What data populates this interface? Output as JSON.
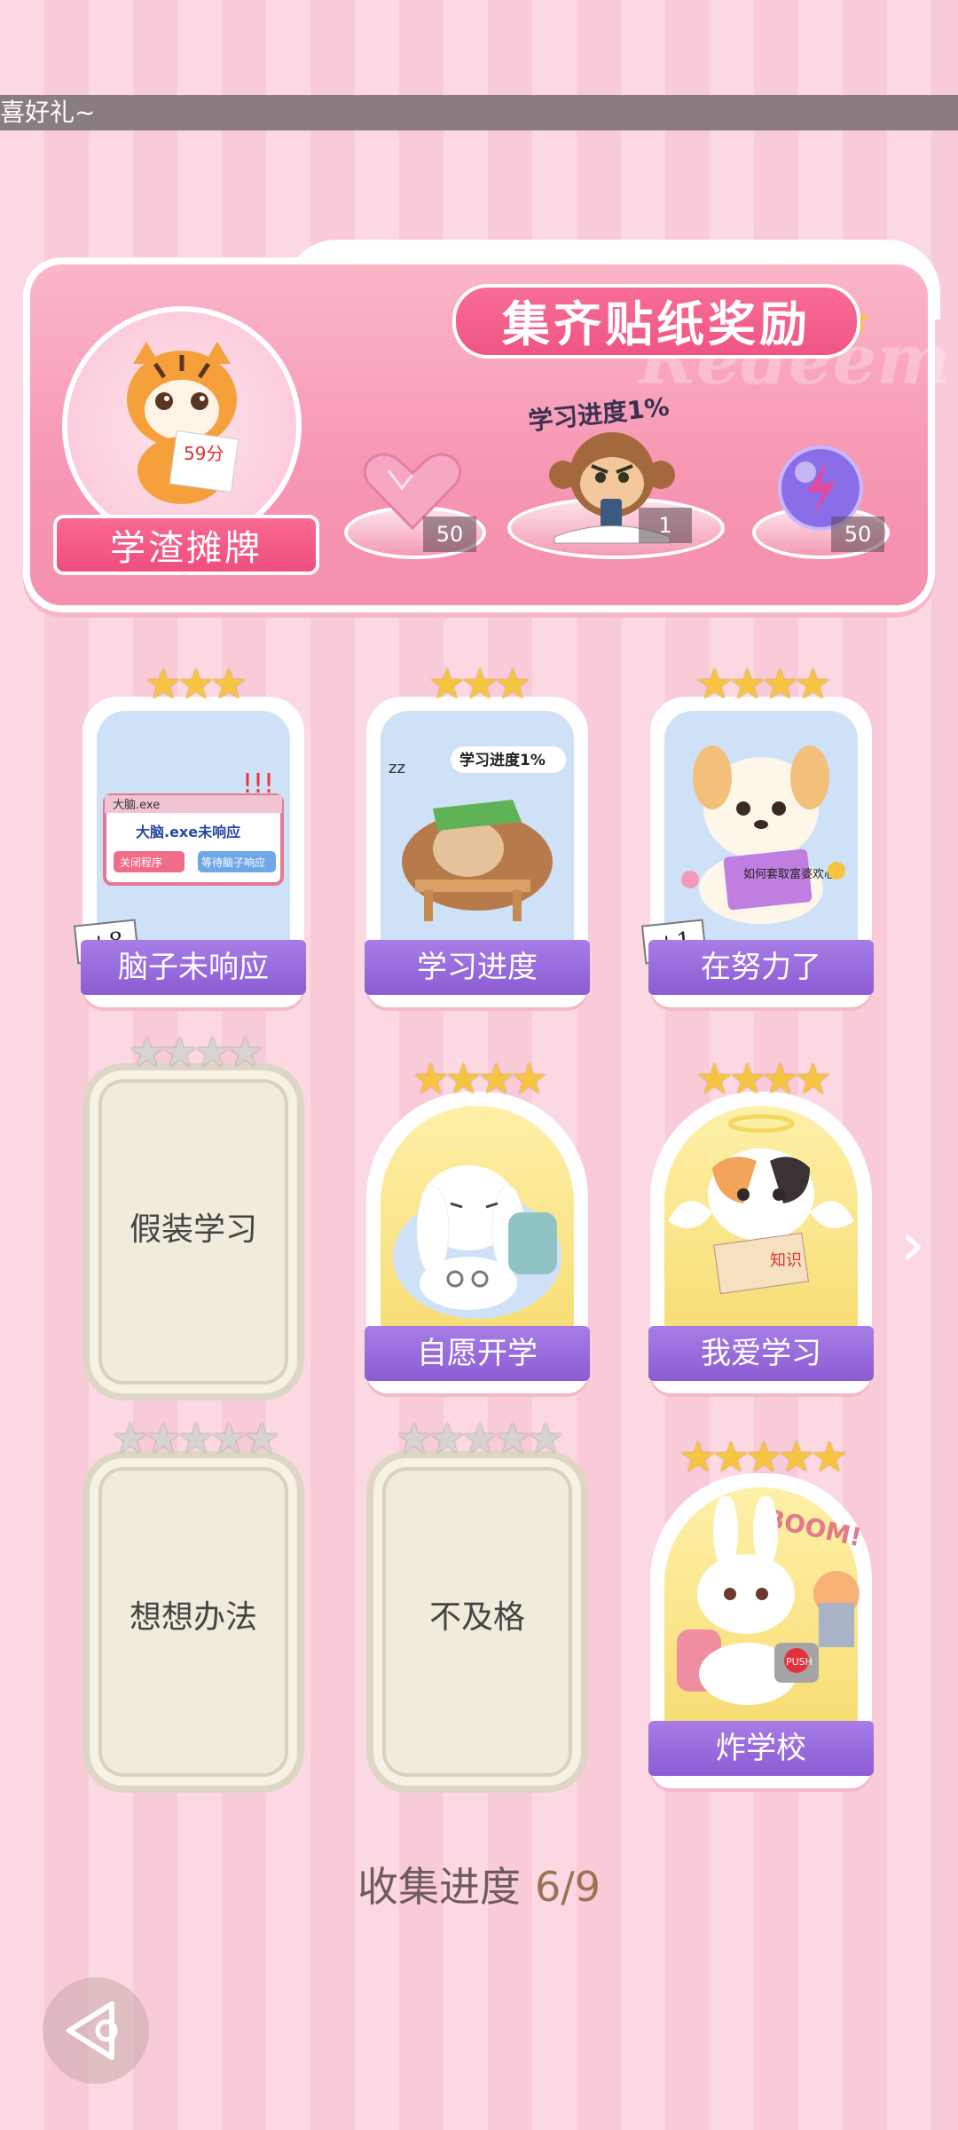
{
  "marquee": {
    "text": "喜好礼~"
  },
  "banner": {
    "title": "集齐贴纸奖励",
    "ghost_text": "Redeem",
    "sticker_name": "学渣摊牌",
    "tiger_score": "59分",
    "rewards": [
      {
        "name": "heart-gem",
        "count": "50"
      },
      {
        "name": "monkey-sticker",
        "label": "学习进度1%",
        "count": "1"
      },
      {
        "name": "energy-orb",
        "count": "50"
      }
    ]
  },
  "cards": [
    {
      "label": "脑子未响应",
      "stars": 3,
      "collected": true,
      "plus": "+8",
      "art_text_1": "大脑.exe",
      "art_text_2": "大脑.exe未响应",
      "art_btn_1": "关闭程序",
      "art_btn_2": "等待脑子响应"
    },
    {
      "label": "学习进度",
      "stars": 3,
      "collected": true,
      "art_text_1": "学习进度1%"
    },
    {
      "label": "在努力了",
      "stars": 4,
      "collected": true,
      "plus": "+1",
      "art_text_1": "如何套取富婆欢心"
    },
    {
      "label": "假装学习",
      "stars": 4,
      "collected": false
    },
    {
      "label": "自愿开学",
      "stars": 4,
      "collected": true
    },
    {
      "label": "我爱学习",
      "stars": 4,
      "collected": true,
      "art_text_1": "知识"
    },
    {
      "label": "想想办法",
      "stars": 5,
      "collected": false
    },
    {
      "label": "不及格",
      "stars": 5,
      "collected": false
    },
    {
      "label": "炸学校",
      "stars": 5,
      "collected": true,
      "art_text_1": "BOOM!!",
      "art_text_2": "PUSH"
    }
  ],
  "progress": {
    "label": "收集进度",
    "value": "6/9"
  },
  "colors": {
    "purple_label": "#8b5cd3",
    "pink_banner": "#f797b3",
    "gold_star": "#f5c542"
  }
}
